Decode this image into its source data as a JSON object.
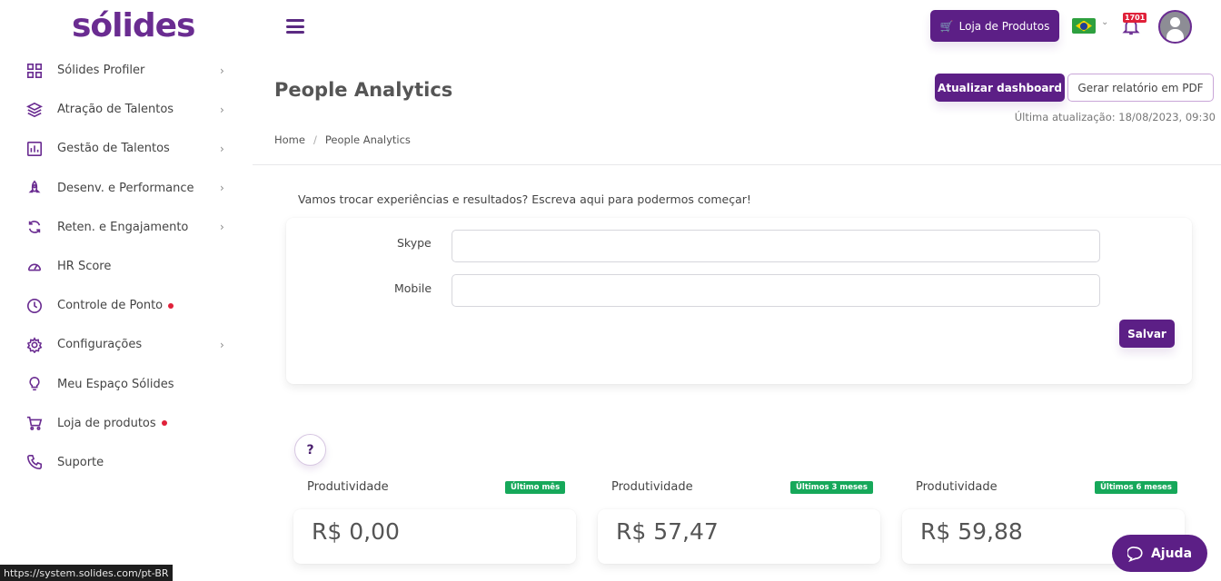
{
  "brand": {
    "logo": "sólides"
  },
  "sidebar": {
    "items": [
      {
        "label": "Sólides Profiler",
        "icon": "grid-icon",
        "has_chevron": true,
        "dot": false
      },
      {
        "label": "Atração de Talentos",
        "icon": "layers-icon",
        "has_chevron": true,
        "dot": false
      },
      {
        "label": "Gestão de Talentos",
        "icon": "bar-chart-icon",
        "has_chevron": true,
        "dot": false
      },
      {
        "label": "Desenv. e Performance",
        "icon": "rocket-icon",
        "has_chevron": true,
        "dot": false
      },
      {
        "label": "Reten. e Engajamento",
        "icon": "refresh-icon",
        "has_chevron": true,
        "dot": false
      },
      {
        "label": "HR Score",
        "icon": "gauge-icon",
        "has_chevron": false,
        "dot": false
      },
      {
        "label": "Controle de Ponto",
        "icon": "clock-icon",
        "has_chevron": false,
        "dot": true
      },
      {
        "label": "Configurações",
        "icon": "gear-icon",
        "has_chevron": true,
        "dot": false
      },
      {
        "label": "Meu Espaço Sólides",
        "icon": "lightbulb-icon",
        "has_chevron": false,
        "dot": false
      },
      {
        "label": "Loja de produtos",
        "icon": "cart-icon",
        "has_chevron": false,
        "dot": true
      },
      {
        "label": "Suporte",
        "icon": "phone-icon",
        "has_chevron": false,
        "dot": false
      }
    ]
  },
  "header": {
    "store_button": "Loja de Produtos",
    "notification_count": "1701",
    "language_flag": "brazil-flag-icon"
  },
  "page": {
    "title": "People Analytics",
    "update_button": "Atualizar dashboard",
    "pdf_button": "Gerar relatório em PDF",
    "last_update": "Última atualização: 18/08/2023, 09:30",
    "breadcrumb": {
      "home": "Home",
      "separator": "/",
      "current": "People Analytics"
    }
  },
  "contact_form": {
    "intro": "Vamos trocar experiências e resultados? Escreva aqui para podermos começar!",
    "skype_label": "Skype",
    "skype_value": "",
    "mobile_label": "Mobile",
    "mobile_value": "",
    "save_button": "Salvar"
  },
  "kpis": [
    {
      "title": "Produtividade",
      "badge": "Último mês",
      "value": "R$ 0,00"
    },
    {
      "title": "Produtividade",
      "badge": "Últimos 3 meses",
      "value": "R$ 57,47"
    },
    {
      "title": "Produtividade",
      "badge": "Últimos 6 meses",
      "value": "R$ 59,88"
    }
  ],
  "help": {
    "question_mark": "?",
    "chat_button": "Ajuda"
  },
  "status_bar": {
    "url": "https://system.solides.com/pt-BR"
  },
  "colors": {
    "brand_purple": "#5c1f86",
    "badge_green": "#16a85a",
    "alert_red": "#e0213a"
  }
}
